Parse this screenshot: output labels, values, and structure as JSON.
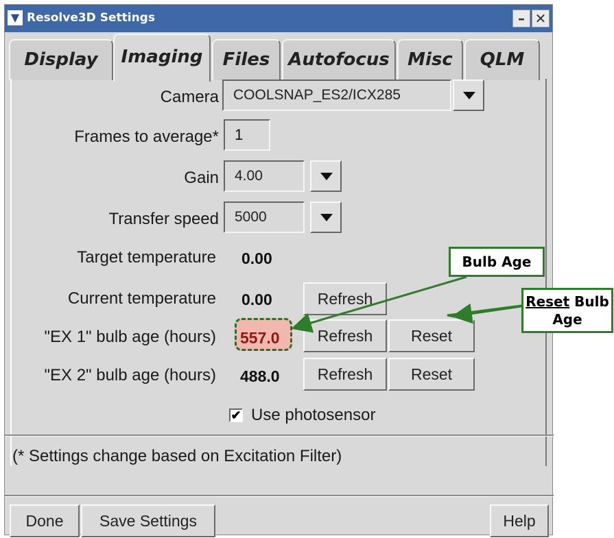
{
  "window": {
    "title": "Resolve3D Settings",
    "menu_icon": "chevron-down-icon",
    "minimize_icon": "minimize-icon",
    "close_icon": "close-icon"
  },
  "tabs": [
    {
      "label": "Display"
    },
    {
      "label": "Imaging",
      "active": true
    },
    {
      "label": "Files"
    },
    {
      "label": "Autofocus"
    },
    {
      "label": "Misc"
    },
    {
      "label": "QLM"
    }
  ],
  "form": {
    "camera_label": "Camera",
    "camera_value": "COOLSNAP_ES2/ICX285",
    "frames_label": "Frames to average*",
    "frames_value": "1",
    "gain_label": "Gain",
    "gain_value": "4.00",
    "transfer_label": "Transfer speed",
    "transfer_value": "5000",
    "target_temp_label": "Target temperature",
    "target_temp_value": "0.00",
    "current_temp_label": "Current temperature",
    "current_temp_value": "0.00",
    "ex1_label": "\"EX 1\" bulb age (hours)",
    "ex1_value": "557.0",
    "ex2_label": "\"EX 2\" bulb age (hours)",
    "ex2_value": "488.0",
    "refresh_label": "Refresh",
    "reset_label": "Reset",
    "photosensor_label": "Use photosensor",
    "photosensor_checked": true,
    "note": "(* Settings change based on Excitation Filter)"
  },
  "footer": {
    "done": "Done",
    "save": "Save Settings",
    "help": "Help"
  },
  "annotations": {
    "bulb_age": "Bulb Age",
    "reset_underlined": "Reset",
    "reset_rest_line1": " Bulb",
    "reset_rest_line2": "Age",
    "color": "#2f7d2a",
    "highlight_color": "#f2b8b0"
  }
}
